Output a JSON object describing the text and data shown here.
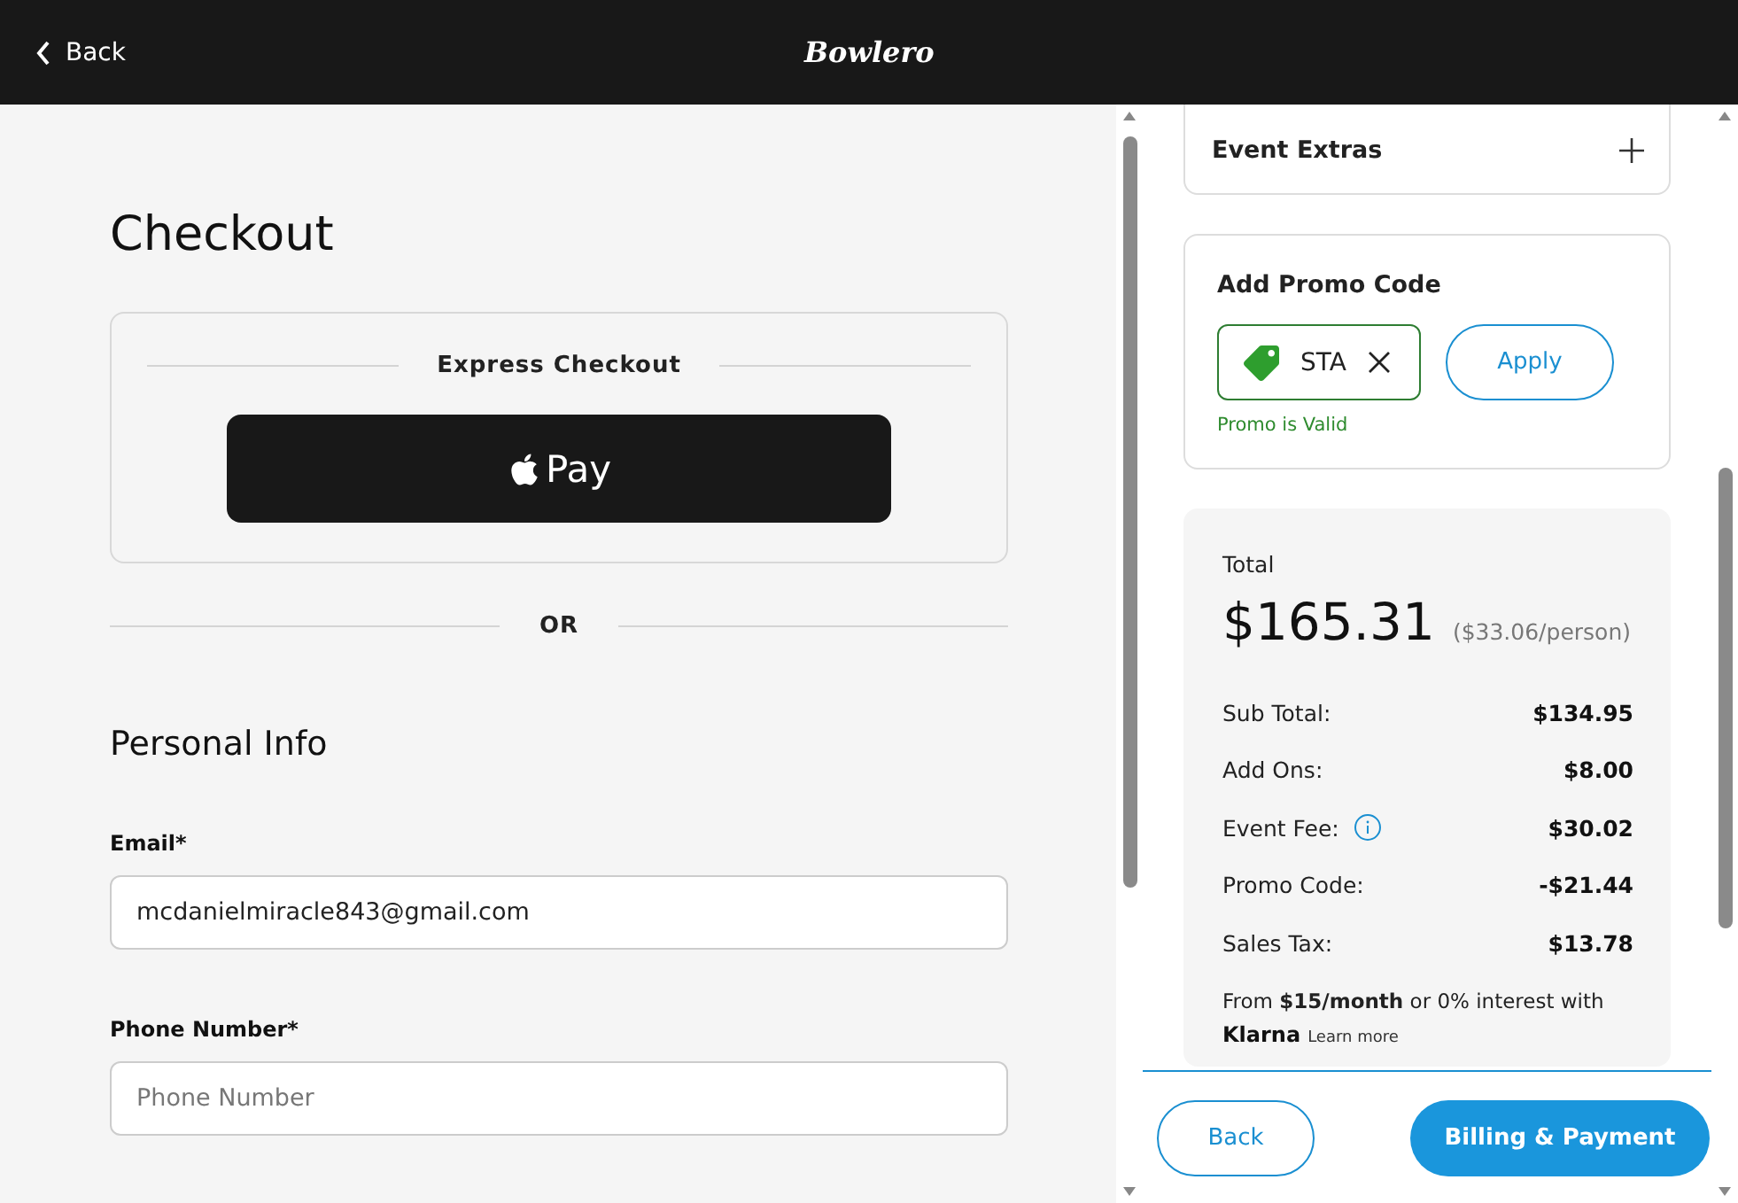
{
  "header": {
    "back": "Back",
    "logo": "Bowlero"
  },
  "checkout": {
    "title": "Checkout",
    "express_title": "Express Checkout",
    "pay_button": "Pay",
    "divider": "OR",
    "section_title": "Personal Info",
    "fields": [
      {
        "label": "Email*",
        "value": "mcdanielmiracle843@gmail.com"
      },
      {
        "label": "Phone Number*",
        "placeholder": "Phone Number"
      }
    ]
  },
  "extras": {
    "title": "Event Extras",
    "expanded": false
  },
  "promo": {
    "title": "Add Promo Code",
    "code": "STA",
    "apply": "Apply",
    "message": "Promo is Valid",
    "valid": true
  },
  "summary": {
    "total_label": "Total",
    "total": "$165.31",
    "per_person": "($33.06/person)",
    "rows": [
      {
        "label": "Sub Total:",
        "value": "$134.95",
        "info": false
      },
      {
        "label": "Add Ons:",
        "value": "$8.00",
        "info": false
      },
      {
        "label": "Event Fee:",
        "value": "$30.02",
        "info": true
      },
      {
        "label": "Promo Code:",
        "value": "-$21.44",
        "info": false
      },
      {
        "label": "Sales Tax:",
        "value": "$13.78",
        "info": false
      }
    ],
    "financing": "From **$15/month** or 0% interest with",
    "klarna": "Klarna",
    "learn_more": "Learn more"
  },
  "footer": {
    "back": "Back",
    "next": "Billing & Payment"
  }
}
